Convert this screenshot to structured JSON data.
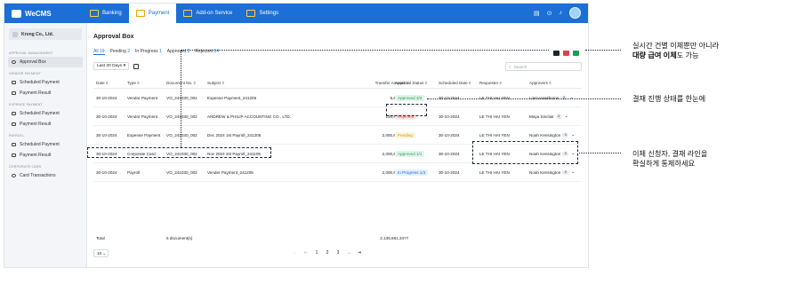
{
  "app": {
    "brand": "WeCMS",
    "nav": [
      {
        "label": "Banking",
        "active": false
      },
      {
        "label": "Payment",
        "active": true
      },
      {
        "label": "Add-on Service",
        "active": false
      },
      {
        "label": "Settings",
        "active": false
      }
    ]
  },
  "sidebar": {
    "company": "Krong Co., Ltd.",
    "approval_section": "APPROVAL MANAGEMENT",
    "approval_box": "Approval Box",
    "vendor_section": "VENDOR PAYMENT",
    "vendor_scheduled": "Scheduled Payment",
    "vendor_result": "Payment Result",
    "expense_section": "EXPENSE PAYMENT",
    "expense_scheduled": "Scheduled Payment",
    "expense_result": "Payment Result",
    "payroll_section": "PAYROLL",
    "payroll_scheduled": "Scheduled Payment",
    "payroll_result": "Payment Result",
    "card_section": "CORPORATE CARD",
    "card_transactions": "Card Transactions"
  },
  "main": {
    "title": "Approval Box",
    "tabs": [
      {
        "label": "All",
        "count": "19"
      },
      {
        "label": "Pending",
        "count": "2"
      },
      {
        "label": "In Progress",
        "count": "1"
      },
      {
        "label": "Approved",
        "count": "2"
      },
      {
        "label": "Rejected",
        "count": "14"
      }
    ],
    "date_filter": "Last 30 Days",
    "search_placeholder": "Search"
  },
  "table": {
    "headers": {
      "date": "Date ◊",
      "type": "Type ◊",
      "doc": "Document No. ◊",
      "subject": "Subject ◊",
      "amount": "Transfer Amount ◊",
      "status": "Approval Status ◊",
      "scheduled": "Scheduled Date ◊",
      "requester": "Requester ◊",
      "approvers": "Approvers ◊"
    },
    "rows": [
      {
        "date": "30-10-2024",
        "type": "Vendor Payment",
        "doc": "VO_241030_002",
        "subject": "Expense Payment_241205",
        "amount": "5,661,347",
        "status": "Approved 3/3",
        "status_kind": "approved",
        "scheduled": "30-10-2024",
        "requester": "LE THI HAI YEN",
        "approver": "Liam Hawthorne",
        "more": "3"
      },
      {
        "date": "30-10-2024",
        "type": "Vendor Payment",
        "doc": "VO_241030_002",
        "subject": "ANDREW & PHILIP ACCOUNTING CO., LTD.",
        "amount": "130,661,347",
        "status": "Rejected",
        "status_kind": "rejected",
        "scheduled": "30-10-2024",
        "requester": "LE THI HAI YEN",
        "approver": "Maya Sinclair",
        "more": "3"
      },
      {
        "date": "30-10-2024",
        "type": "Expense Payment",
        "doc": "VO_241030_002",
        "subject": "Dec 2024 1st Payroll_241205",
        "amount": "2,000,661,347",
        "status": "Pending",
        "status_kind": "pending",
        "scheduled": "30-10-2024",
        "requester": "LE THI HAI YEN",
        "approver": "Noah Kensington",
        "more": "3"
      },
      {
        "date": "30-10-2024",
        "type": "Corporate Card",
        "doc": "VO_241030_002",
        "subject": "Nov 2024 2st Payroll_241105",
        "amount": "2,000,661,347",
        "status": "Approved 1/1",
        "status_kind": "approved",
        "scheduled": "30-10-2024",
        "requester": "LE THI HAI YEN",
        "approver": "Noah Kensington",
        "more": "3"
      },
      {
        "date": "30-10-2024",
        "type": "Payroll",
        "doc": "VO_241030_002",
        "subject": "Vender Payment_241205",
        "amount": "2,000,661,347",
        "status": "In Progress 1/3",
        "status_kind": "progress",
        "scheduled": "30-10-2024",
        "requester": "LE THI HAI YEN",
        "approver": "Noah Kensington",
        "more": "3"
      }
    ],
    "total_label": "Total",
    "total_docs": "5 document(s)",
    "total_amount": "2,135,661,347₫"
  },
  "pagination": {
    "page_size": "10",
    "first": "⇤",
    "prev": "←",
    "pages": [
      "1",
      "2",
      "3"
    ],
    "next": "→",
    "last": "⇥"
  },
  "callouts": {
    "top_line1": "실시간 건별 이체뿐만 아니라",
    "top_line2_bold": "대량 급여 이체",
    "top_line2_rest": "도 가능",
    "middle": "결재 진행 상태를 한눈에",
    "bottom_line1": "이체 신청자, 결재 라인을",
    "bottom_line2": "확실하게 통제하세요"
  },
  "colors": {
    "brand": "#1b6fd6",
    "approved_bg": "#e3f6ea",
    "approved_fg": "#1f9d55",
    "rejected_bg": "#fde8e8",
    "rejected_fg": "#e0424b",
    "pending_bg": "#fff6db",
    "pending_fg": "#c99700",
    "progress_bg": "#e4efff",
    "progress_fg": "#1b6fd6"
  }
}
